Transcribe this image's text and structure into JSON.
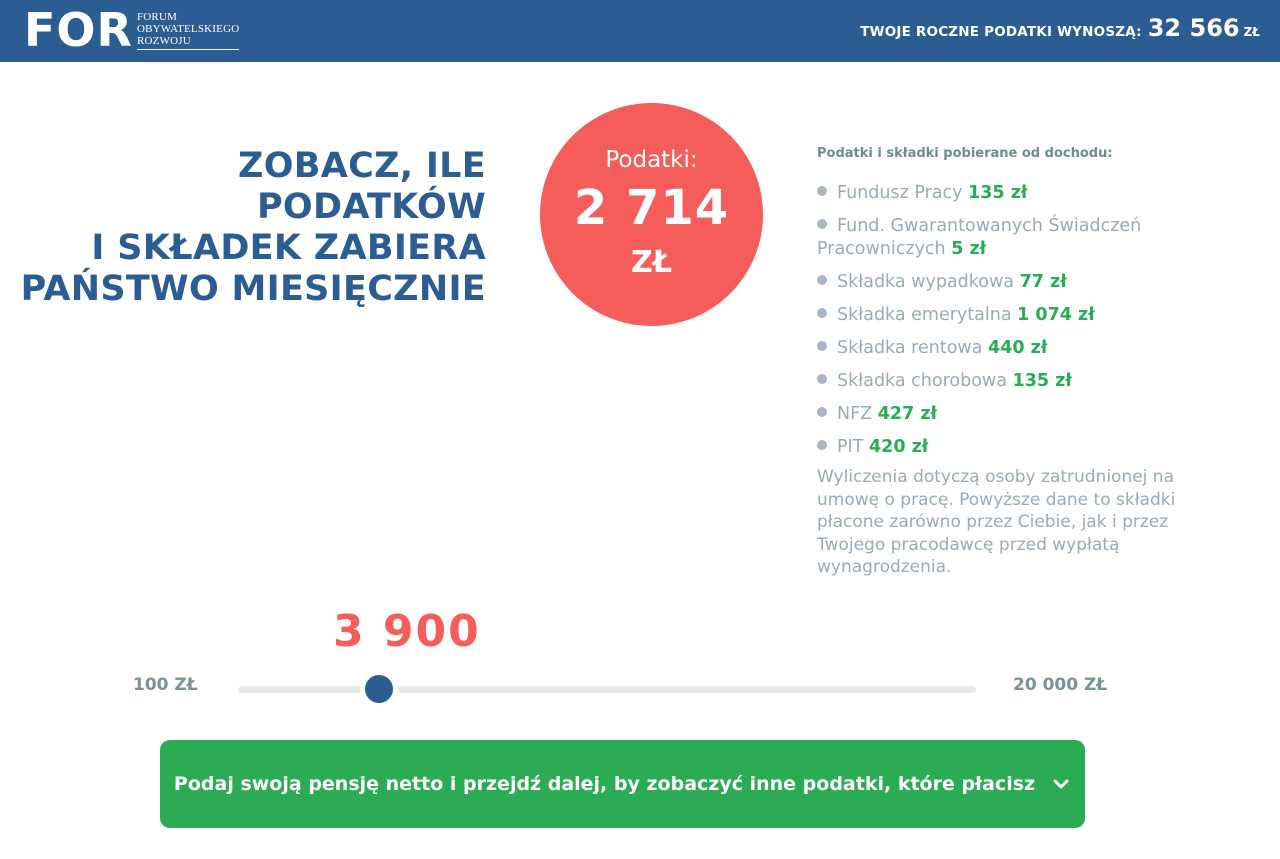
{
  "header": {
    "logo_mark": "FOR",
    "logo_lines": [
      "FORUM",
      "OBYWATELSKIEGO",
      "ROZWOJU"
    ],
    "annual_label": "TWOJE ROCZNE PODATKI WYNOSZĄ:",
    "annual_value": "32 566",
    "annual_unit": "ZŁ"
  },
  "headline": {
    "lines": [
      "ZOBACZ, ILE PODATKÓW",
      "I SKŁADEK ZABIERA",
      "PAŃSTWO MIESIĘCZNIE"
    ]
  },
  "summary": {
    "label": "Podatki:",
    "value": "2 714",
    "unit": "ZŁ",
    "color": "#f45d5a"
  },
  "breakdown": {
    "title": "Podatki i składki pobierane od dochodu:",
    "items": [
      {
        "name": "Fundusz Pracy",
        "amount": "135 zł"
      },
      {
        "name": "Fund. Gwarantowanych Świadczeń Pracowniczych",
        "amount": "5 zł"
      },
      {
        "name": "Składka wypadkowa",
        "amount": "77 zł"
      },
      {
        "name": "Składka emerytalna",
        "amount": "1 074 zł"
      },
      {
        "name": "Składka rentowa",
        "amount": "440 zł"
      },
      {
        "name": "Składka chorobowa",
        "amount": "135 zł"
      },
      {
        "name": "NFZ",
        "amount": "427 zł"
      },
      {
        "name": "PIT",
        "amount": "420 zł"
      }
    ],
    "note": "Wyliczenia dotyczą osoby zatrudnionej na umowę o pracę. Powyższe dane to składki płacone zarówno przez Ciebie, jak i przez Twojego pracodawcę przed wypłatą wynagrodzenia."
  },
  "slider": {
    "value_label": "3 900",
    "value": 3900,
    "min": 100,
    "max": 20000,
    "min_label": "100 ZŁ",
    "max_label": "20 000 ZŁ"
  },
  "cta": {
    "label": "Podaj swoją pensję netto i przejdź dalej, by zobaczyć inne podatki, które płacisz",
    "icon": "chevron-down-icon"
  },
  "colors": {
    "brand_blue": "#2b5d93",
    "accent_red": "#f45d5a",
    "accent_green": "#2bac54"
  }
}
